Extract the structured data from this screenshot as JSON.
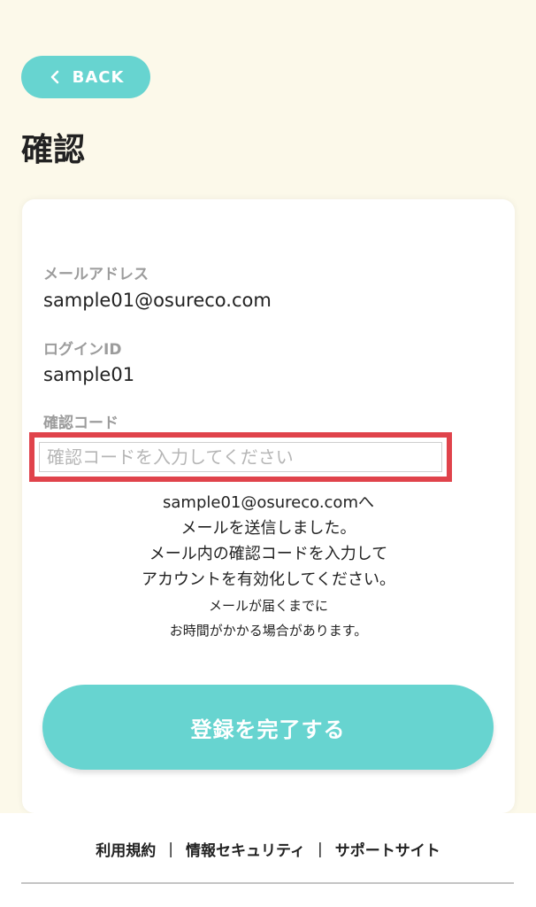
{
  "header": {
    "back_label": "BACK",
    "back_icon": "chevron-left-icon",
    "title": "確認"
  },
  "form": {
    "email_label": "メールアドレス",
    "email_value": "sample01@osureco.com",
    "login_id_label": "ログインID",
    "login_id_value": "sample01",
    "code_label": "確認コード",
    "code_placeholder": "確認コードを入力してください",
    "code_value": ""
  },
  "message": {
    "line1": "sample01@osureco.comへ",
    "line2": "メールを送信しました。",
    "line3": "メール内の確認コードを入力して",
    "line4": "アカウントを有効化してください。",
    "note1": "メールが届くまでに",
    "note2": "お時間がかかる場合があります。"
  },
  "submit": {
    "label": "登録を完了する"
  },
  "footer": {
    "links": [
      "利用規約",
      "情報セキュリティ",
      "サポートサイト"
    ],
    "separator": "|"
  },
  "colors": {
    "accent": "#67d4d0",
    "background": "#fcf9ea",
    "highlight": "#e0434b"
  }
}
